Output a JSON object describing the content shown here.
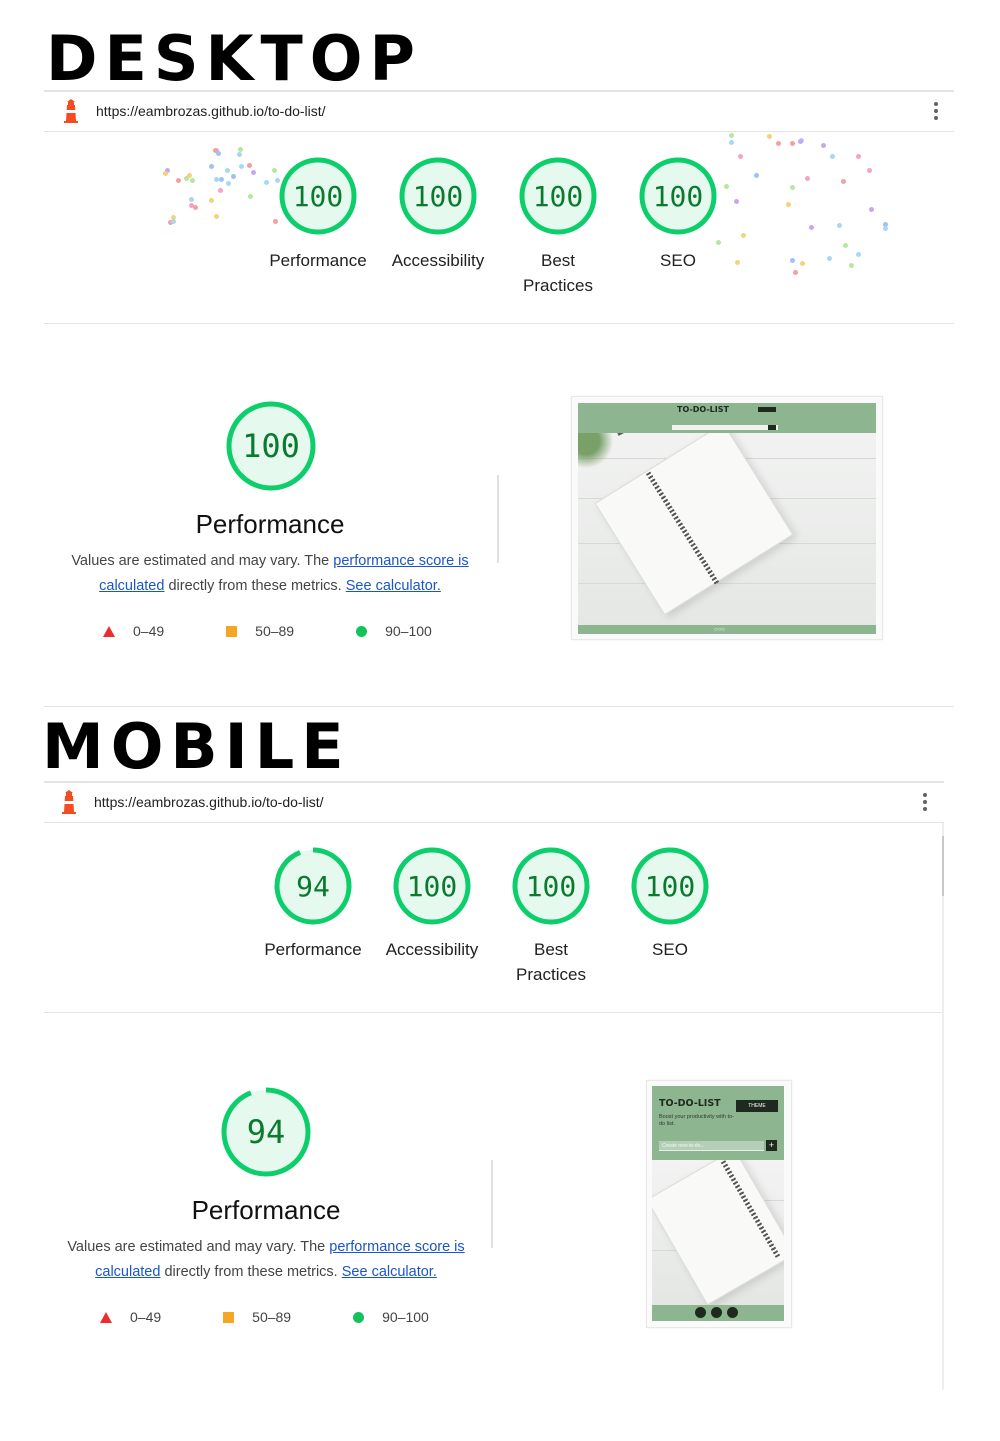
{
  "desktop": {
    "heading": "DESKTOP",
    "url": "https://eambrozas.github.io/to-do-list/",
    "scores": [
      {
        "value": "100",
        "label": "Performance",
        "fraction": 1.0
      },
      {
        "value": "100",
        "label": "Accessibility",
        "fraction": 1.0
      },
      {
        "value": "100",
        "label": "Best Practices",
        "fraction": 1.0
      },
      {
        "value": "100",
        "label": "SEO",
        "fraction": 1.0
      }
    ],
    "performance": {
      "score": "100",
      "fraction": 1.0,
      "title": "Performance",
      "desc_prefix": "Values are estimated and may vary. The ",
      "link1": "performance score is calculated",
      "desc_mid": " directly from these metrics. ",
      "link2": "See calculator."
    },
    "screenshot": {
      "app_title": "TO-DO-LIST"
    }
  },
  "mobile": {
    "heading": "MOBILE",
    "url": "https://eambrozas.github.io/to-do-list/",
    "scores": [
      {
        "value": "94",
        "label": "Performance",
        "fraction": 0.94
      },
      {
        "value": "100",
        "label": "Accessibility",
        "fraction": 1.0
      },
      {
        "value": "100",
        "label": "Best Practices",
        "fraction": 1.0
      },
      {
        "value": "100",
        "label": "SEO",
        "fraction": 1.0
      }
    ],
    "performance": {
      "score": "94",
      "fraction": 0.94,
      "title": "Performance",
      "desc_prefix": "Values are estimated and may vary. The ",
      "link1": "performance score is calculated",
      "desc_mid": " directly from these metrics. ",
      "link2": "See calculator."
    },
    "screenshot": {
      "app_title": "TO-DO-LIST",
      "theme_label": "THEME",
      "subtitle": "Boost your productivity with to-do list.",
      "input_placeholder": "Create new to-do..."
    }
  },
  "legend": {
    "low": "0–49",
    "mid": "50–89",
    "high": "90–100"
  },
  "colors": {
    "pass": "#0cce6b",
    "pass_text": "#0a7a2f",
    "pass_bg": "#e6f9ee",
    "average": "#ffa400",
    "fail": "#ff4e42",
    "link": "#1a55c9"
  }
}
